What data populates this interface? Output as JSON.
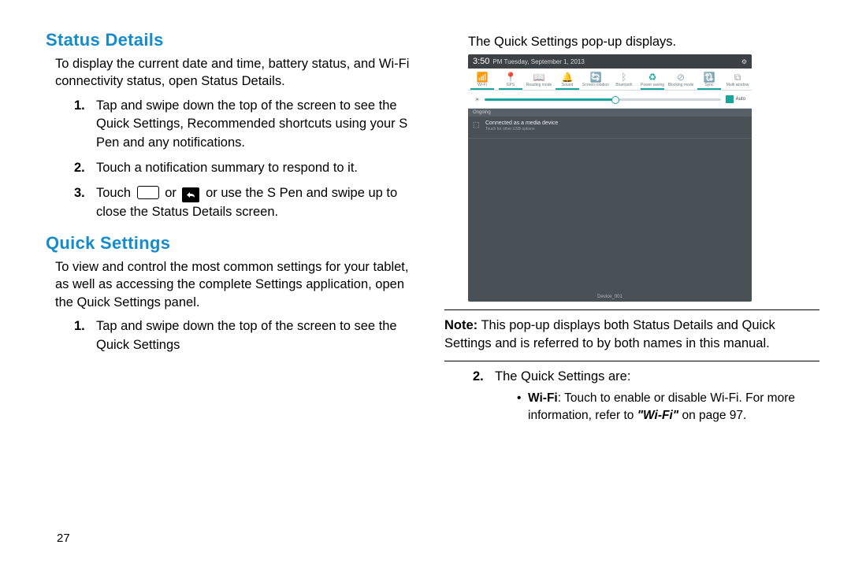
{
  "page_number": "27",
  "left": {
    "heading1": "Status Details",
    "intro1": "To display the current date and time, battery status, and Wi-Fi connectivity status, open Status Details.",
    "steps1": [
      "Tap and swipe down the top of the screen to see the Quick Settings, Recommended shortcuts using your S Pen and any notifications.",
      "Touch a notification summary to respond to it."
    ],
    "step3_pre": "Touch ",
    "step3_mid": " or ",
    "step3_post": " or use the S Pen and swipe up to close the Status Details screen.",
    "heading2": "Quick Settings",
    "intro2": "To view and control the most common settings for your tablet, as well as accessing the complete Settings application, open the Quick Settings panel.",
    "steps2": [
      "Tap and swipe down the top of the screen to see the Quick Settings"
    ]
  },
  "right": {
    "caption": "The Quick Settings pop-up displays.",
    "shot": {
      "time": "3:50",
      "date": "PM  Tuesday, September 1, 2013",
      "toggles": [
        "Wi-Fi",
        "GPS",
        "Reading mode",
        "Sound",
        "Screen rotation",
        "Bluetooth",
        "Power saving",
        "Blocking mode",
        "Sync",
        "Multi window"
      ],
      "toggles_on": [
        true,
        true,
        false,
        true,
        false,
        false,
        true,
        false,
        true,
        false
      ],
      "auto": "Auto",
      "notif_header": "Ongoing",
      "notif_title": "Connected as a media device",
      "notif_sub": "Touch for other USB options",
      "carrier": "Device_001"
    },
    "note_label": "Note:",
    "note_text": " This pop-up displays both Status Details and Quick Settings and is referred to by both names in this manual.",
    "step2_lead": "The Quick Settings are:",
    "bullet_label": "Wi-Fi",
    "bullet_text": ": Touch to enable or disable Wi-Fi. For more information, refer to ",
    "bullet_ref": "\"Wi-Fi\"",
    "bullet_tail": " on page 97."
  }
}
